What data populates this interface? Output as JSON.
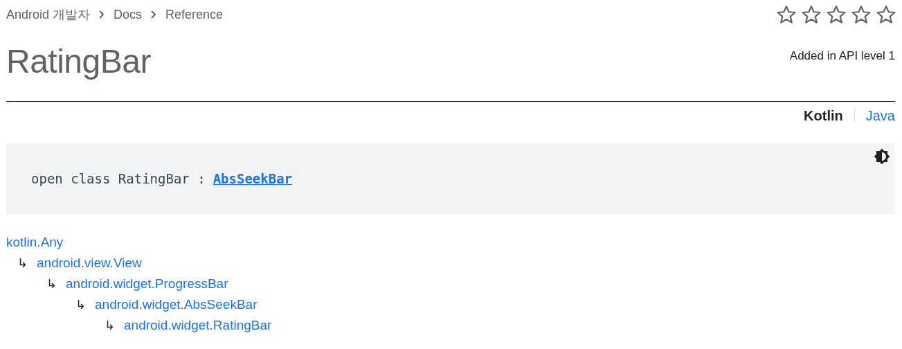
{
  "breadcrumb": [
    "Android 개발자",
    "Docs",
    "Reference"
  ],
  "rating": {
    "stars": 0
  },
  "title": "RatingBar",
  "api_level": "Added in API level 1",
  "language_tabs": [
    {
      "label": "Kotlin",
      "selected": true
    },
    {
      "label": "Java",
      "selected": false
    }
  ],
  "code": {
    "text": "open class RatingBar :",
    "link": "AbsSeekBar"
  },
  "hierarchy": {
    "name": "kotlin.Any",
    "children": [
      {
        "arrow": "↳",
        "name": "android.view.View",
        "children": [
          {
            "arrow": "↳",
            "name": "android.widget.ProgressBar",
            "children": [
              {
                "arrow": "↳",
                "name": "android.widget.AbsSeekBar",
                "children": [
                  {
                    "arrow": "↳",
                    "name": "android.widget.RatingBar"
                  }
                ]
              }
            ]
          }
        ]
      }
    ]
  }
}
